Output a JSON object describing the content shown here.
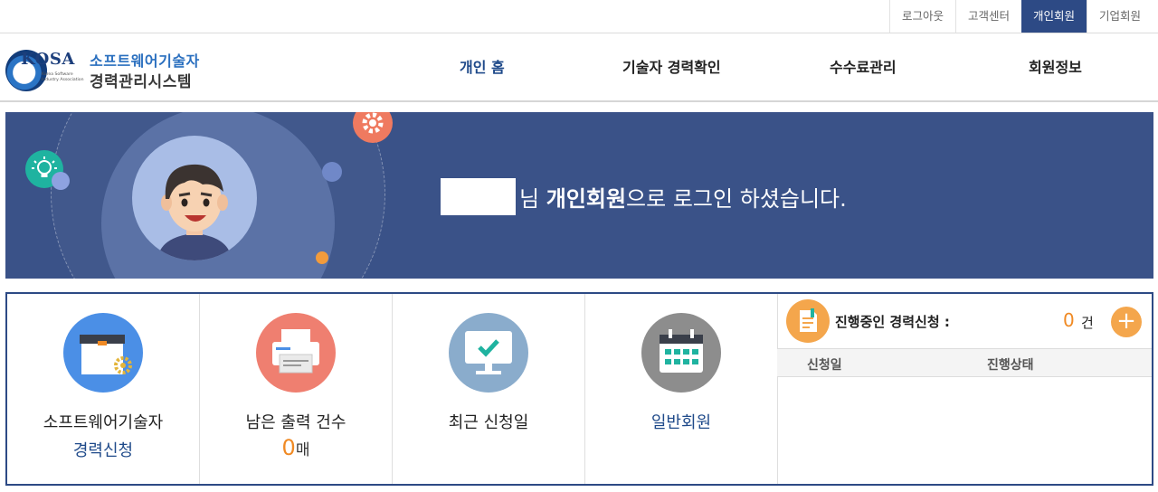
{
  "util_links": [
    "로그아웃",
    "고객센터",
    "개인회원",
    "기업회원"
  ],
  "logo": {
    "brand": "KOSA",
    "sub": "Korea Software Industry Association",
    "title1": "소프트웨어기술자",
    "title2": "경력관리시스템"
  },
  "nav": [
    "개인 홈",
    "기술자 경력확인",
    "수수료관리",
    "회원정보"
  ],
  "banner": {
    "suffix": "님 ",
    "bold": "개인회원",
    "rest": "으로 로그인 하셨습니다."
  },
  "cards": {
    "apply": {
      "line1": "소프트웨어기술자",
      "line2": "경력신청"
    },
    "print": {
      "label": "남은 출력 건수",
      "count": "0",
      "unit": "매"
    },
    "recent": {
      "label": "최근 신청일"
    },
    "member": {
      "label": "일반회원"
    }
  },
  "status": {
    "title": "진행중인 경력신청 :",
    "count": "0",
    "unit": "건",
    "add": "+",
    "columns": [
      "신청일",
      "진행상태"
    ]
  },
  "colors": {
    "navy": "#2d4a85",
    "banner": "#3a5288",
    "accent_orange": "#f08a24"
  },
  "icons": [
    "kosa-logo-icon",
    "gear-icon",
    "lightbulb-icon",
    "user-avatar-icon",
    "box-gear-icon",
    "printer-icon",
    "monitor-check-icon",
    "calendar-icon",
    "document-icon",
    "plus-icon"
  ]
}
